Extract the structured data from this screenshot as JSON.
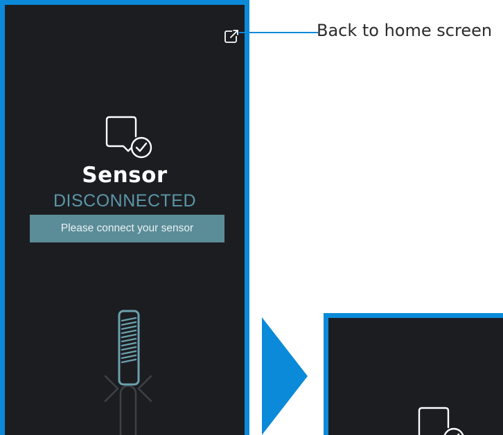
{
  "screen": {
    "title": "Sensor",
    "status": "DISCONNECTED",
    "instruction": "Please connect your sensor"
  },
  "annotation": {
    "home_button_label": "Back to home screen"
  },
  "icons": {
    "home_button": "external-link-icon",
    "status_icon": "sensor-check-icon",
    "sensor": "sensor-device-icon",
    "next": "arrow-right-icon"
  },
  "colors": {
    "screen_background": "#1c1d21",
    "frame_border": "#0b8ad9",
    "status_text": "#5b97a8",
    "instruction_background": "#5b8d98",
    "title_text": "#ffffff",
    "callout_text": "#2b2b2b"
  }
}
